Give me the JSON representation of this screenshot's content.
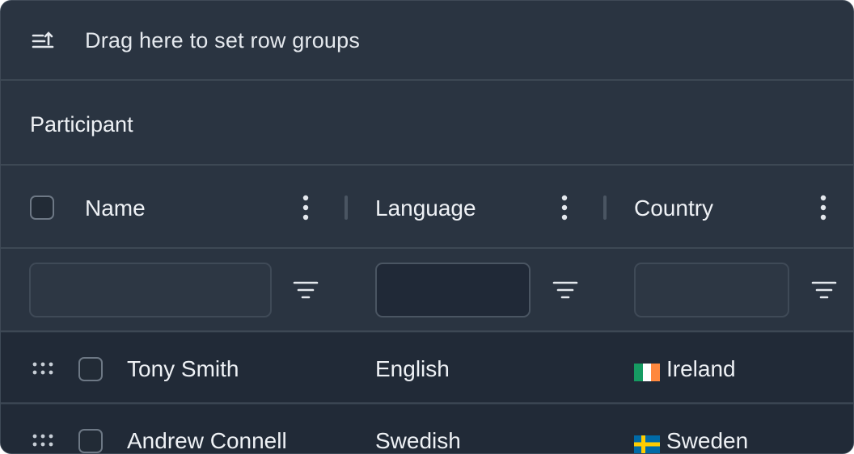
{
  "group_panel": {
    "icon": "row-group-icon",
    "text": "Drag here to set row groups"
  },
  "header_group": {
    "label": "Participant"
  },
  "columns": [
    {
      "title": "Name",
      "menu_icon": "column-menu-icon"
    },
    {
      "title": "Language",
      "menu_icon": "column-menu-icon"
    },
    {
      "title": "Country",
      "menu_icon": "column-menu-icon"
    }
  ],
  "filters": [
    {
      "value": "",
      "icon": "filter-icon"
    },
    {
      "value": "",
      "icon": "filter-icon"
    },
    {
      "value": "",
      "icon": "filter-icon"
    }
  ],
  "rows": [
    {
      "name": "Tony Smith",
      "language": "English",
      "country": "Ireland",
      "flag_icon": "ireland-flag-icon"
    },
    {
      "name": "Andrew Connell",
      "language": "Swedish",
      "country": "Sweden",
      "flag_icon": "sweden-flag-icon"
    }
  ],
  "colors": {
    "background": "#2a3441",
    "row_background": "#212a37",
    "border": "#3d4854",
    "text": "#eef1f5"
  }
}
